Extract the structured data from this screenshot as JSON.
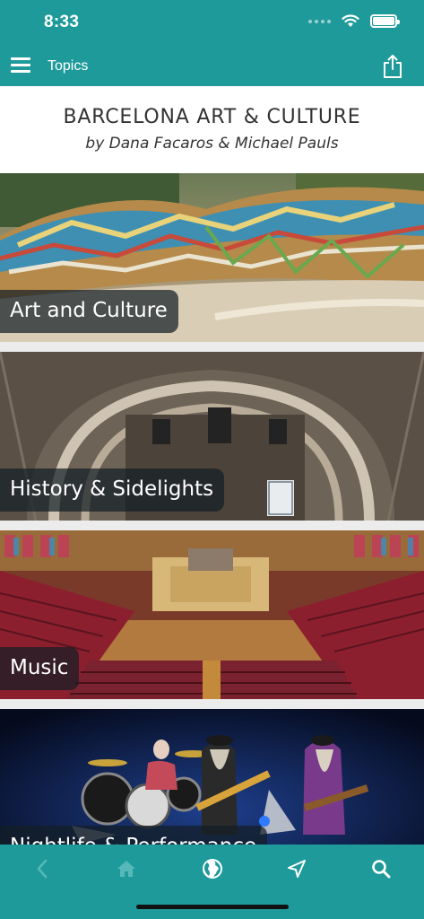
{
  "status": {
    "time": "8:33"
  },
  "nav": {
    "title": "Topics"
  },
  "book": {
    "title": "BARCELONA ART & CULTURE",
    "authors": "by Dana Facaros & Michael Pauls"
  },
  "topics": [
    {
      "label": "Art and Culture"
    },
    {
      "label": "History & Sidelights"
    },
    {
      "label": "Music"
    },
    {
      "label": "Nightlife & Performance"
    }
  ],
  "toolbar": {
    "icons": [
      "back-icon",
      "home-icon",
      "globe-icon",
      "location-arrow-icon",
      "search-icon"
    ]
  },
  "colors": {
    "primary": "#1f9a9a",
    "label_bg": "#141e26"
  }
}
